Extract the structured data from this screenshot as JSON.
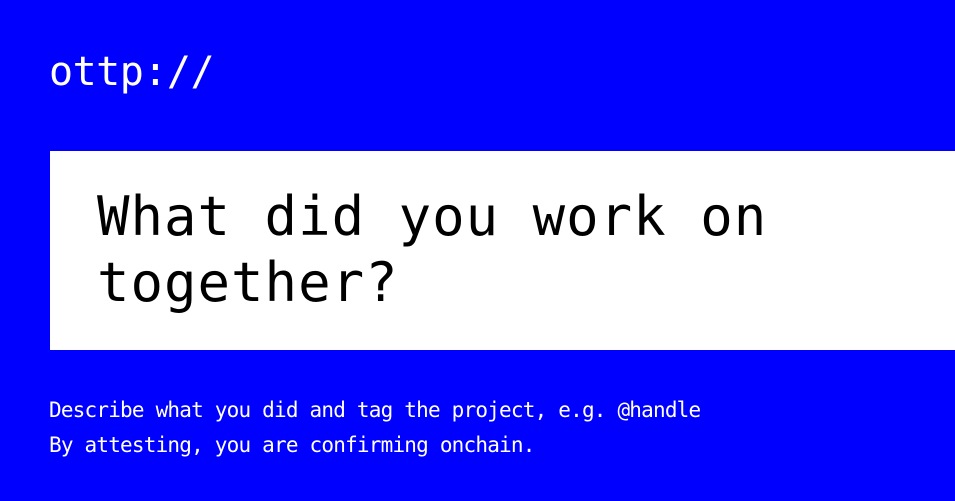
{
  "brand": {
    "logo_text": "ottp://"
  },
  "prompt": {
    "question": "What did you work on together?"
  },
  "caption": {
    "line1": "Describe what you did and tag the project, e.g. @handle",
    "line2": "By attesting, you are confirming onchain."
  },
  "colors": {
    "background": "#0000ff",
    "card": "#ffffff",
    "question_text": "#000000",
    "caption_text": "#ffffff"
  }
}
